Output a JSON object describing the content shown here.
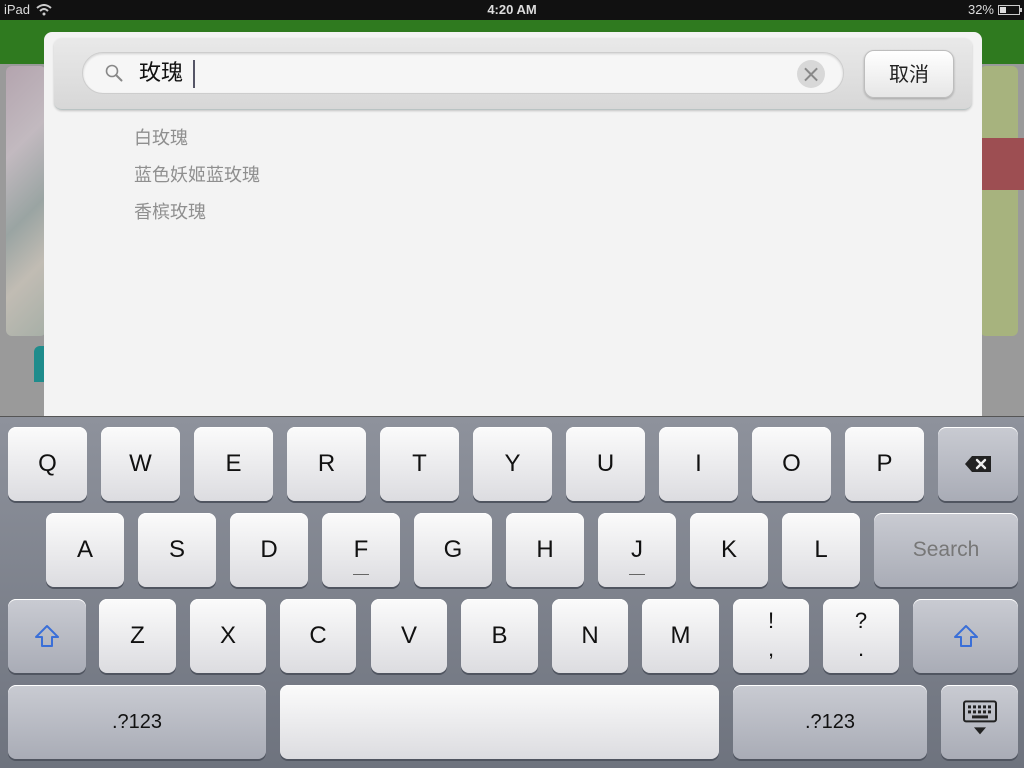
{
  "status_bar": {
    "device": "iPad",
    "time": "4:20 AM",
    "battery": "32%"
  },
  "search": {
    "query": "玫瑰",
    "cancel_label": "取消",
    "suggestions": [
      "白玫瑰",
      "蓝色妖姬蓝玫瑰",
      "香槟玫瑰"
    ]
  },
  "keyboard": {
    "row1": [
      "Q",
      "W",
      "E",
      "R",
      "T",
      "Y",
      "U",
      "I",
      "O",
      "P"
    ],
    "row2": [
      "A",
      "S",
      "D",
      "F",
      "G",
      "H",
      "J",
      "K",
      "L"
    ],
    "row3": [
      "Z",
      "X",
      "C",
      "V",
      "B",
      "N",
      "M"
    ],
    "punct1": [
      "!",
      ","
    ],
    "punct2": [
      "?",
      "."
    ],
    "search_label": "Search",
    "numbers_label": ".?123",
    "icons": {
      "delete": "backspace-icon",
      "shift": "shift-arrow-icon",
      "dismiss": "keyboard-dismiss-icon"
    }
  },
  "colors": {
    "navbar_green": "#2f7a1f",
    "suggestion_text": "#8f8f8f",
    "shift_blue": "#3a6fd8"
  }
}
